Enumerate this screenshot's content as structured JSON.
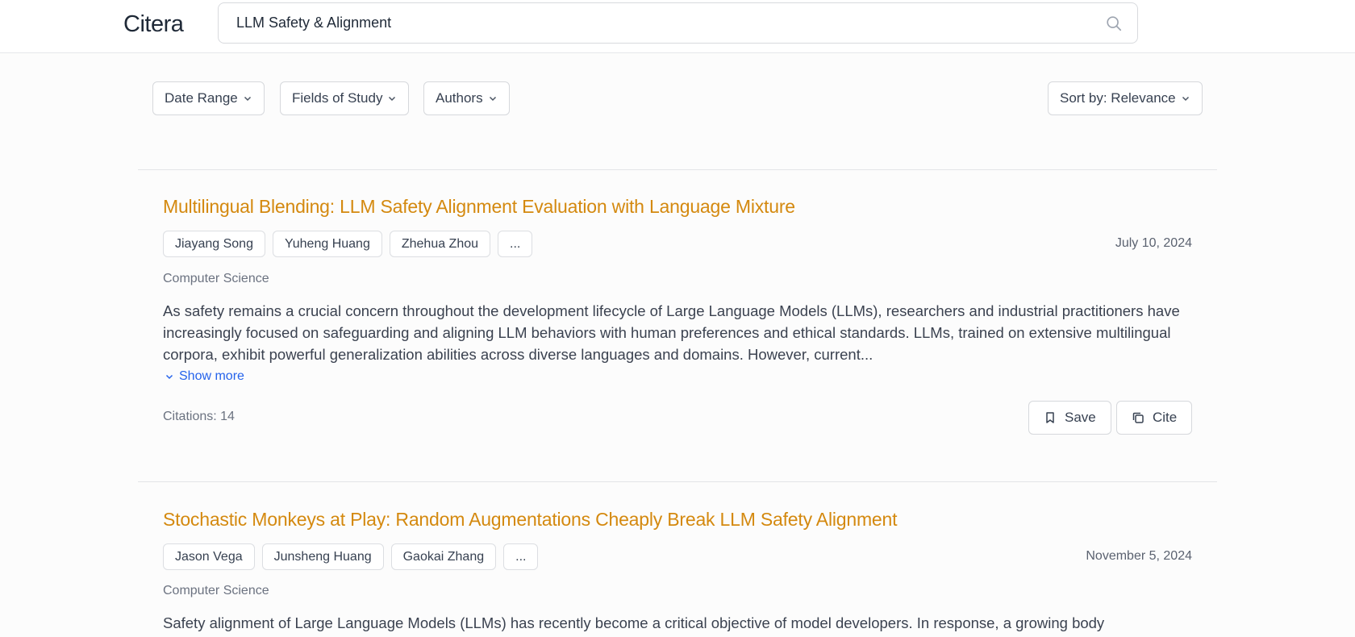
{
  "app": {
    "name": "Citera"
  },
  "search": {
    "query": "LLM Safety & Alignment",
    "icon": "search-icon"
  },
  "filters": {
    "date_range": "Date Range",
    "fields_of_study": "Fields of Study",
    "authors": "Authors",
    "sort": "Sort by: Relevance"
  },
  "actions": {
    "save": "Save",
    "cite": "Cite",
    "show_more": "Show more"
  },
  "colors": {
    "title": "#d4890f",
    "link": "#2563eb"
  },
  "results": [
    {
      "title": "Multilingual Blending: LLM Safety Alignment Evaluation with Language Mixture",
      "authors": [
        "Jiayang Song",
        "Yuheng Huang",
        "Zhehua Zhou",
        "..."
      ],
      "date": "July 10, 2024",
      "field": "Computer Science",
      "abstract": "As safety remains a crucial concern throughout the development lifecycle of Large Language Models (LLMs), researchers and industrial practitioners have increasingly focused on safeguarding and aligning LLM behaviors with human preferences and ethical standards. LLMs, trained on extensive multilingual corpora, exhibit powerful generalization abilities across diverse languages and domains. However, current...",
      "citations": "Citations: 14"
    },
    {
      "title": "Stochastic Monkeys at Play: Random Augmentations Cheaply Break LLM Safety Alignment",
      "authors": [
        "Jason Vega",
        "Junsheng Huang",
        "Gaokai Zhang",
        "..."
      ],
      "date": "November 5, 2024",
      "field": "Computer Science",
      "abstract": "Safety alignment of Large Language Models (LLMs) has recently become a critical objective of model developers. In response, a growing body"
    }
  ]
}
